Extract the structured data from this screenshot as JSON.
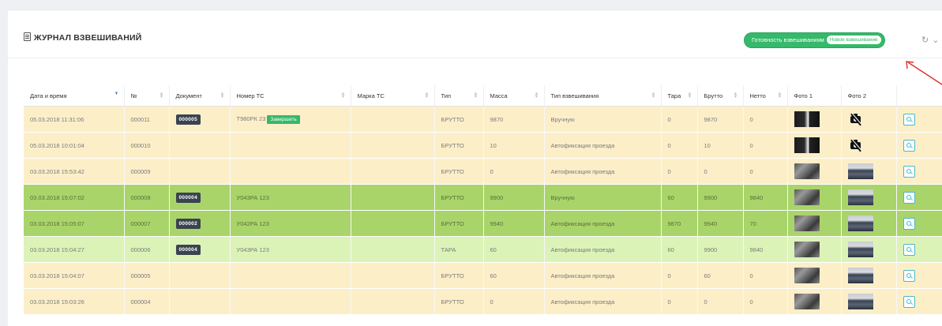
{
  "panel": {
    "title": "ЖУРНАЛ ВЗВЕШИВАНИЙ",
    "readiness_label": "Готовность взвешиваниям",
    "readiness_pill": "Новое взвешивание"
  },
  "table": {
    "columns": [
      "Дата и время",
      "№",
      "Документ",
      "Номер ТС",
      "Марка ТС",
      "Тип",
      "Масса",
      "Тип взвешивания",
      "Тара",
      "Брутто",
      "Нетто",
      "Фото 1",
      "Фото 2",
      ""
    ],
    "finish_label": "Завершить",
    "rows": [
      {
        "date": "05.03.2018 11:31:06",
        "num": "000011",
        "doc": "000005",
        "plate": "Т980РК 23",
        "brand": "",
        "type": "БРУТТО",
        "mass": "9870",
        "wtype": "Вручную",
        "tare": "0",
        "brutto": "9870",
        "netto": "0",
        "photo1": "dark",
        "photo2": "none",
        "color": "yellow",
        "finish": true
      },
      {
        "date": "05.03.2018 10:01:04",
        "num": "000010",
        "doc": "",
        "plate": "",
        "brand": "",
        "type": "БРУТТО",
        "mass": "10",
        "wtype": "Автофиксация проезда",
        "tare": "0",
        "brutto": "10",
        "netto": "0",
        "photo1": "dark",
        "photo2": "none",
        "color": "yellow",
        "finish": false
      },
      {
        "date": "03.03.2018 15:53:42",
        "num": "000009",
        "doc": "",
        "plate": "",
        "brand": "",
        "type": "БРУТТО",
        "mass": "0",
        "wtype": "Автофиксация проезда",
        "tare": "0",
        "brutto": "0",
        "netto": "0",
        "photo1": "camera",
        "photo2": "barn",
        "color": "yellow",
        "finish": false
      },
      {
        "date": "03.03.2018 15:07:02",
        "num": "000008",
        "doc": "000004",
        "plate": "У043РА 123",
        "brand": "",
        "type": "БРУТТО",
        "mass": "9900",
        "wtype": "Вручную",
        "tare": "60",
        "brutto": "9900",
        "netto": "9840",
        "photo1": "camera",
        "photo2": "barn",
        "color": "green",
        "finish": false
      },
      {
        "date": "03.03.2018 15:05:07",
        "num": "000007",
        "doc": "000002",
        "plate": "У042РА 123",
        "brand": "",
        "type": "БРУТТО",
        "mass": "9940",
        "wtype": "Автофиксация проезда",
        "tare": "9870",
        "brutto": "9940",
        "netto": "70",
        "photo1": "camera",
        "photo2": "barn",
        "color": "green",
        "finish": false
      },
      {
        "date": "03.03.2018 15:04:27",
        "num": "000006",
        "doc": "000004",
        "plate": "У043РА 123",
        "brand": "",
        "type": "ТАРА",
        "mass": "60",
        "wtype": "Автофиксация проезда",
        "tare": "60",
        "brutto": "9900",
        "netto": "9840",
        "photo1": "camera",
        "photo2": "barn",
        "color": "lightgreen",
        "finish": false
      },
      {
        "date": "03.03.2018 15:04:07",
        "num": "000005",
        "doc": "",
        "plate": "",
        "brand": "",
        "type": "БРУТТО",
        "mass": "60",
        "wtype": "Автофиксация проезда",
        "tare": "0",
        "brutto": "60",
        "netto": "0",
        "photo1": "camera",
        "photo2": "barn",
        "color": "yellow",
        "finish": false
      },
      {
        "date": "03.03.2018 15:03:26",
        "num": "000004",
        "doc": "",
        "plate": "",
        "brand": "",
        "type": "БРУТТО",
        "mass": "0",
        "wtype": "Автофиксация проезда",
        "tare": "0",
        "brutto": "0",
        "netto": "0",
        "photo1": "camera",
        "photo2": "barn",
        "color": "yellow",
        "finish": false
      }
    ]
  },
  "icons": {
    "refresh": "refresh-icon",
    "dropdown": "chevron-down-icon",
    "view": "magnifier-icon"
  },
  "colors": {
    "accent_green": "#35b96a",
    "row_yellow": "#fcefc8",
    "row_green": "#a9d46a",
    "row_lightgreen": "#dcf3b8",
    "annotation_arrow": "#e0302a"
  }
}
